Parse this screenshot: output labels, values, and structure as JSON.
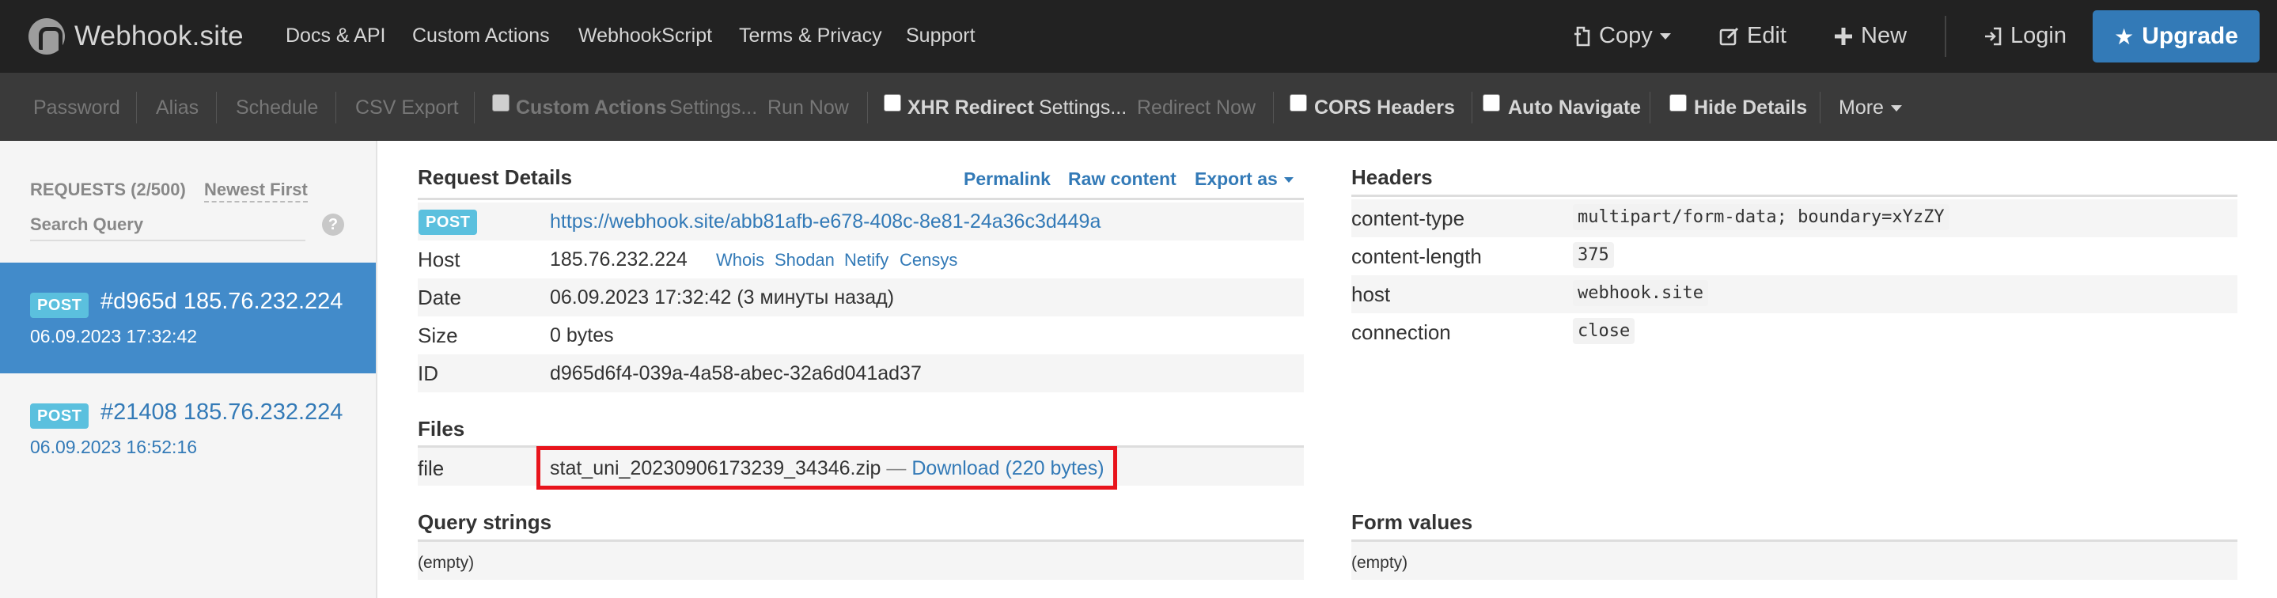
{
  "navbar": {
    "brand": "Webhook.site",
    "links": [
      "Docs & API",
      "Custom Actions",
      "WebhookScript",
      "Terms & Privacy",
      "Support"
    ],
    "copy": "Copy",
    "edit": "Edit",
    "new": "New",
    "login": "Login",
    "upgrade": "Upgrade"
  },
  "toolbar": {
    "password": "Password",
    "alias": "Alias",
    "schedule": "Schedule",
    "csv_export": "CSV Export",
    "custom_actions": "Custom Actions",
    "ca_settings": "Settings...",
    "run_now": "Run Now",
    "xhr_redirect": "XHR Redirect",
    "xhr_settings": "Settings...",
    "redirect_now": "Redirect Now",
    "cors_headers": "CORS Headers",
    "auto_navigate": "Auto Navigate",
    "hide_details": "Hide Details",
    "more": "More"
  },
  "sidebar": {
    "requests_count": "REQUESTS (2/500)",
    "sort": "Newest First",
    "search_placeholder": "Search Query",
    "help": "?",
    "requests": [
      {
        "method": "POST",
        "title": "#d965d 185.76.232.224",
        "date": "06.09.2023 17:32:42"
      },
      {
        "method": "POST",
        "title": "#21408 185.76.232.224",
        "date": "06.09.2023 16:52:16"
      }
    ]
  },
  "details": {
    "title": "Request Details",
    "permalink": "Permalink",
    "raw_content": "Raw content",
    "export_as": "Export as",
    "method": "POST",
    "url": "https://webhook.site/abb81afb-e678-408c-8e81-24a36c3d449a",
    "host_label": "Host",
    "host": "185.76.232.224",
    "host_links": [
      "Whois",
      "Shodan",
      "Netify",
      "Censys"
    ],
    "date_label": "Date",
    "date": "06.09.2023 17:32:42 (3 минуты назад)",
    "size_label": "Size",
    "size": "0 bytes",
    "id_label": "ID",
    "id": "d965d6f4-039a-4a58-abec-32a6d041ad37"
  },
  "files": {
    "title": "Files",
    "label": "file",
    "filename": "stat_uni_20230906173239_34346.zip",
    "dash": "—",
    "download": "Download (220 bytes)"
  },
  "query_strings": {
    "title": "Query strings",
    "value": "(empty)"
  },
  "headers": {
    "title": "Headers",
    "rows": [
      {
        "name": "content-type",
        "value": "multipart/form-data; boundary=xYzZY"
      },
      {
        "name": "content-length",
        "value": "375"
      },
      {
        "name": "host",
        "value": "webhook.site"
      },
      {
        "name": "connection",
        "value": "close"
      }
    ]
  },
  "form_values": {
    "title": "Form values",
    "value": "(empty)"
  },
  "colors": {
    "navbar": "#222222",
    "toolbar": "#3a3a3a",
    "primary": "#337ab7",
    "active_request": "#428bca",
    "badge": "#5bc0de",
    "highlight": "#e8141c"
  }
}
